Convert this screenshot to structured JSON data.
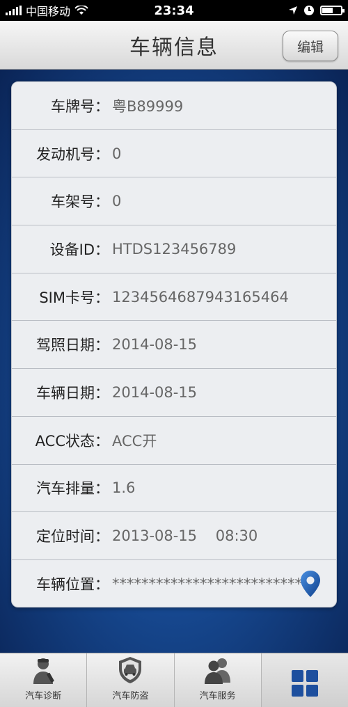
{
  "status_bar": {
    "carrier": "中国移动",
    "time": "23:34",
    "battery_level": 0.55
  },
  "nav": {
    "title": "车辆信息",
    "edit_label": "编辑"
  },
  "info_rows": [
    {
      "label": "车牌号：",
      "value": "粤B89999"
    },
    {
      "label": "发动机号：",
      "value": "0"
    },
    {
      "label": "车架号：",
      "value": "0"
    },
    {
      "label": "设备ID：",
      "value": "HTDS123456789"
    },
    {
      "label": "SIM卡号：",
      "value": "1234564687943165464"
    },
    {
      "label": "驾照日期：",
      "value": "2014-08-15"
    },
    {
      "label": "车辆日期：",
      "value": "2014-08-15"
    },
    {
      "label": "ACC状态：",
      "value": "ACC开"
    },
    {
      "label": "汽车排量：",
      "value": "1.6"
    },
    {
      "label": "定位时间：",
      "value": "2013-08-15    08:30"
    },
    {
      "label": "车辆位置：",
      "value": "**************************"
    }
  ],
  "tabs": [
    {
      "label": "汽车诊断",
      "icon": "mechanic-icon"
    },
    {
      "label": "汽车防盗",
      "icon": "car-shield-icon"
    },
    {
      "label": "汽车服务",
      "icon": "people-icon"
    },
    {
      "label": "",
      "icon": "grid-icon"
    }
  ],
  "colors": {
    "accent": "#1e4f9c",
    "pin": "#1a5fb4"
  }
}
